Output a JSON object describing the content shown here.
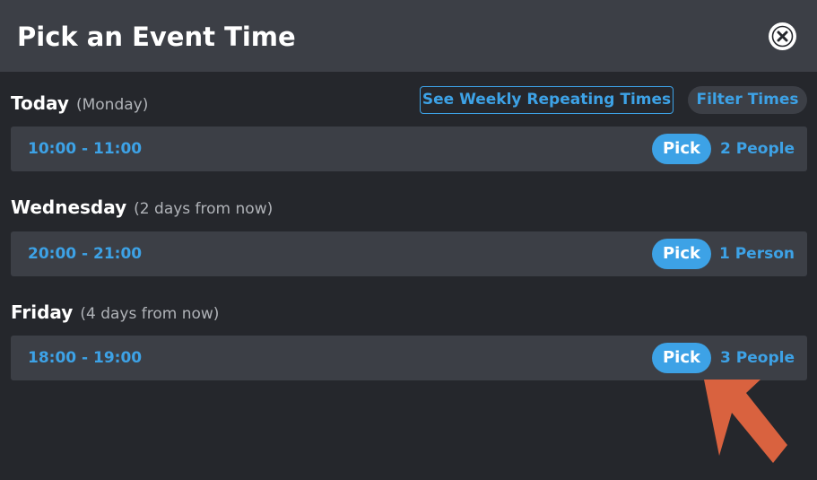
{
  "dialog": {
    "title": "Pick an Event Time",
    "close_icon": "close-icon"
  },
  "toolbar": {
    "weekly_label": "See Weekly Repeating Times",
    "filter_label": "Filter Times"
  },
  "days": [
    {
      "name": "Today",
      "relative": "(Monday)",
      "slots": [
        {
          "time": "10:00 - 11:00",
          "pick_label": "Pick",
          "people": "2 People"
        }
      ]
    },
    {
      "name": "Wednesday",
      "relative": "(2 days from now)",
      "slots": [
        {
          "time": "20:00 - 21:00",
          "pick_label": "Pick",
          "people": "1 Person"
        }
      ]
    },
    {
      "name": "Friday",
      "relative": "(4 days from now)",
      "slots": [
        {
          "time": "18:00 - 19:00",
          "pick_label": "Pick",
          "people": "3 People"
        }
      ]
    }
  ],
  "colors": {
    "background": "#25272c",
    "panel": "#3c3f46",
    "accent": "#3da2e6",
    "annotation": "#d9623f"
  }
}
